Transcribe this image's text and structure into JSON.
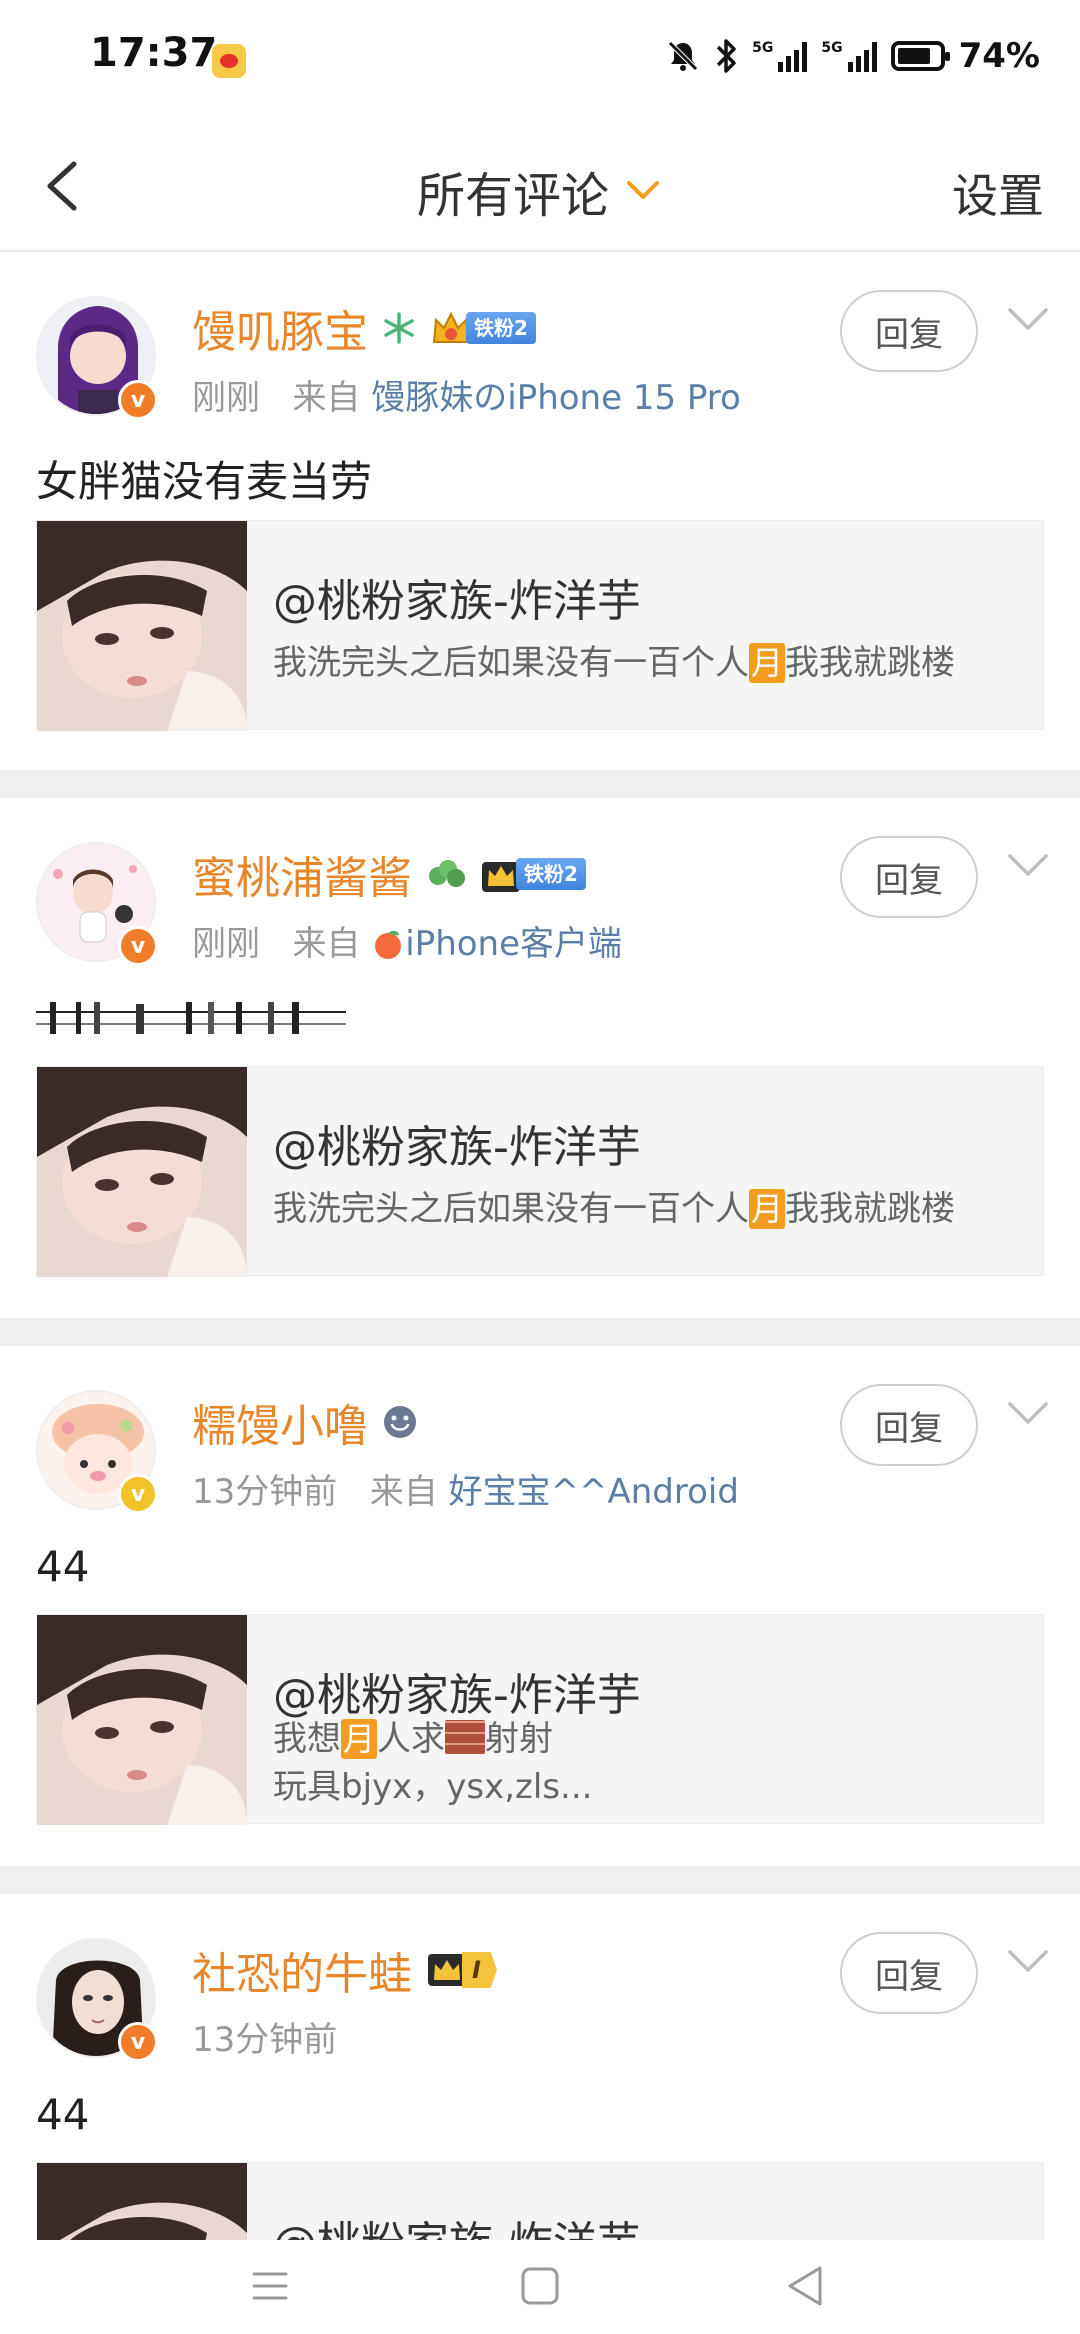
{
  "status_bar": {
    "time": "17:37",
    "app_badge_icon": "weibo-icon",
    "icons": [
      "mute-icon",
      "bluetooth-icon",
      "signal-5g-icon",
      "signal-5g-icon",
      "battery-icon"
    ],
    "network_labels": [
      "5G",
      "5G"
    ],
    "battery": "74%"
  },
  "header": {
    "back_icon": "chevron-left-icon",
    "title": "所有评论",
    "title_dropdown_icon": "chevron-down-icon",
    "accent_color": "#f39c1f",
    "settings_label": "设置"
  },
  "comments": [
    {
      "user_name": "馒叽豚宝",
      "badges": [
        "snowflake-icon",
        "crown-icon"
      ],
      "fan_label": "铁粉2",
      "time": "刚刚",
      "from_label": "来自",
      "source": "馒豚妹のiPhone 15 Pro",
      "text": "女胖猫没有麦当劳",
      "reply_label": "回复",
      "card": {
        "title": "@桃粉家族-炸洋芋",
        "desc_before": "我洗完头之后如果没有一百个人",
        "desc_highlight": "月",
        "desc_after": "我我就跳楼"
      }
    },
    {
      "user_name": "蜜桃浦酱酱",
      "badges": [
        "clover-icon",
        "crown-icon"
      ],
      "fan_label": "铁粉2",
      "time": "刚刚",
      "from_label": "来自",
      "source_icon": "peach-icon",
      "source": "iPhone客户端",
      "text": "",
      "reply_label": "回复",
      "card": {
        "title": "@桃粉家族-炸洋芋",
        "desc_before": "我洗完头之后如果没有一百个人",
        "desc_highlight": "月",
        "desc_after": "我我就跳楼"
      }
    },
    {
      "user_name": "糯馒小噜",
      "badges": [
        "smiley-icon"
      ],
      "time": "13分钟前",
      "from_label": "来自",
      "source": "好宝宝^^Android",
      "text": "44",
      "reply_label": "回复",
      "card": {
        "title": "@桃粉家族-炸洋芋",
        "desc_line1_before": "我想",
        "desc_line1_highlight": "月",
        "desc_line1_mid": "人求",
        "desc_line1_after": "射射",
        "desc_line2": "玩具bjyx，ysx,zls..."
      }
    },
    {
      "user_name": "社恐的牛蛙",
      "badges": [
        "crown-icon"
      ],
      "level_label": "I",
      "time": "13分钟前",
      "text": "44",
      "reply_label": "回复",
      "card": {
        "title": "@桃粉家族-炸洋芋"
      }
    }
  ],
  "nav_bar": {
    "icons": [
      "menu-icon",
      "home-square-icon",
      "back-triangle-icon"
    ]
  }
}
